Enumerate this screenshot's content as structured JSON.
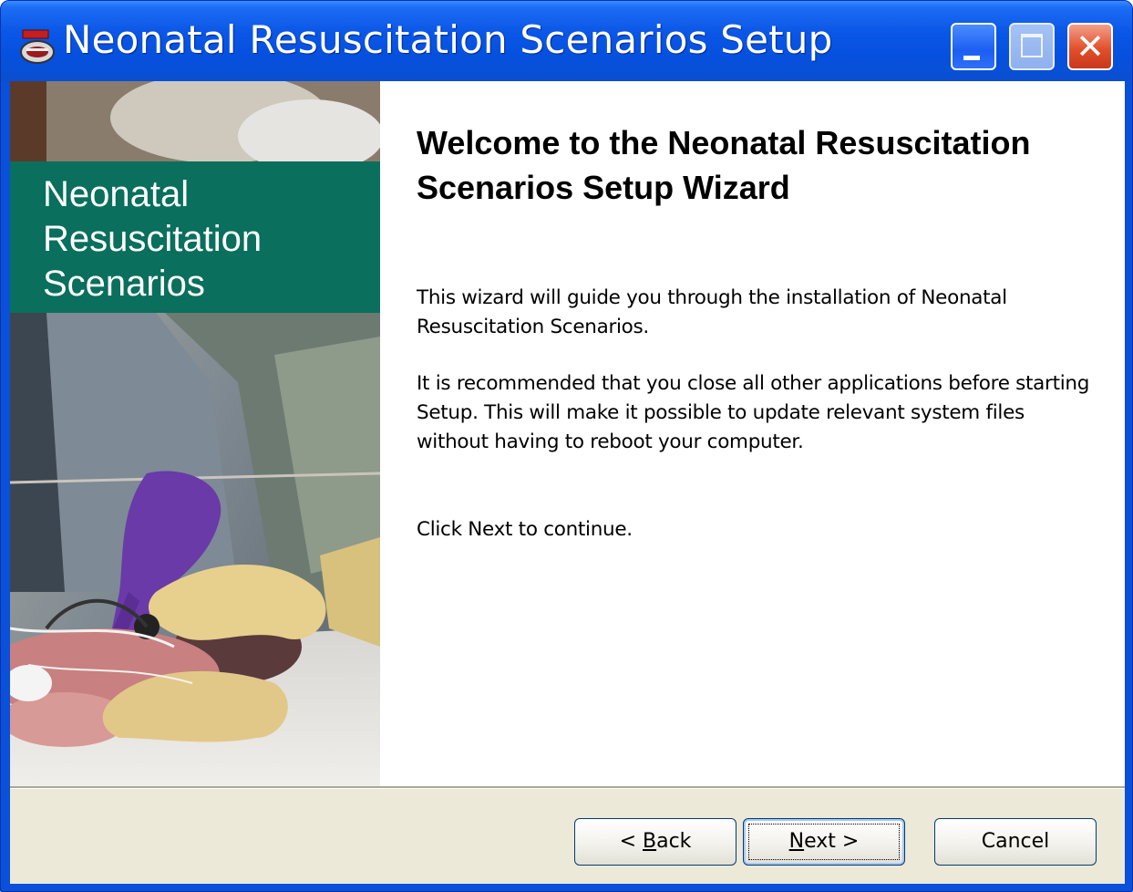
{
  "window": {
    "title": "Neonatal Resuscitation Scenarios Setup",
    "icon": "setup-icon",
    "controls": {
      "minimize": "minimize-icon",
      "maximize": "maximize-icon",
      "close": "close-icon"
    }
  },
  "sidebar": {
    "banner_lines": [
      "Neonatal",
      "Resuscitation",
      "Scenarios"
    ]
  },
  "main": {
    "heading": "Welcome to the Neonatal Resuscitation Scenarios Setup Wizard",
    "paragraphs": [
      "This wizard will guide you through the installation of Neonatal Resuscitation Scenarios.",
      "It is recommended that you close all other applications before starting Setup. This will make it possible to update relevant system files without having to reboot your computer.",
      "Click Next to continue."
    ]
  },
  "buttons": {
    "back": {
      "prefix": "< ",
      "mnemonic": "B",
      "rest": "ack"
    },
    "next": {
      "mnemonic": "N",
      "rest": "ext >"
    },
    "cancel": "Cancel"
  },
  "colors": {
    "titlebar": "#0550de",
    "banner": "#0a6f5c",
    "button_bar": "#ece9d8"
  }
}
